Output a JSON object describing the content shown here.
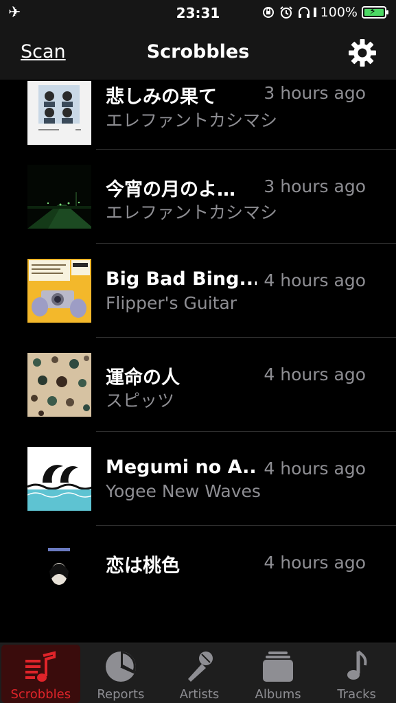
{
  "status_bar": {
    "time": "23:31",
    "battery_percent": "100%",
    "battery_level": 1.0,
    "icons": [
      "airplane-icon",
      "orientation-lock-icon",
      "alarm-icon",
      "headphones-icon",
      "battery-icon"
    ]
  },
  "nav": {
    "scan_label": "Scan",
    "title": "Scrobbles",
    "settings_icon": "gear-icon"
  },
  "scrobbles": [
    {
      "track": "悲しみの果て",
      "artist": "エレファントカシマシ",
      "time": "3 hours ago"
    },
    {
      "track": "今宵の月のよ…",
      "artist": "エレファントカシマシ",
      "time": "3 hours ago"
    },
    {
      "track": "Big Bad Bing...",
      "artist": "Flipper's Guitar",
      "time": "4 hours ago"
    },
    {
      "track": "運命の人",
      "artist": "スピッツ",
      "time": "4 hours ago"
    },
    {
      "track": "Megumi no A...",
      "artist": "Yogee New Waves",
      "time": "4 hours ago"
    },
    {
      "track": "恋は桃色",
      "artist": "",
      "time": "4 hours ago"
    }
  ],
  "tabs": [
    {
      "label": "Scrobbles",
      "icon": "scrobbles-icon",
      "active": true
    },
    {
      "label": "Reports",
      "icon": "pie-chart-icon",
      "active": false
    },
    {
      "label": "Artists",
      "icon": "microphone-icon",
      "active": false
    },
    {
      "label": "Albums",
      "icon": "albums-stack-icon",
      "active": false
    },
    {
      "label": "Tracks",
      "icon": "music-note-icon",
      "active": false
    }
  ],
  "colors": {
    "accent": "#e0242a",
    "secondary_text": "#8e8e93",
    "battery_green": "#4cd964"
  }
}
